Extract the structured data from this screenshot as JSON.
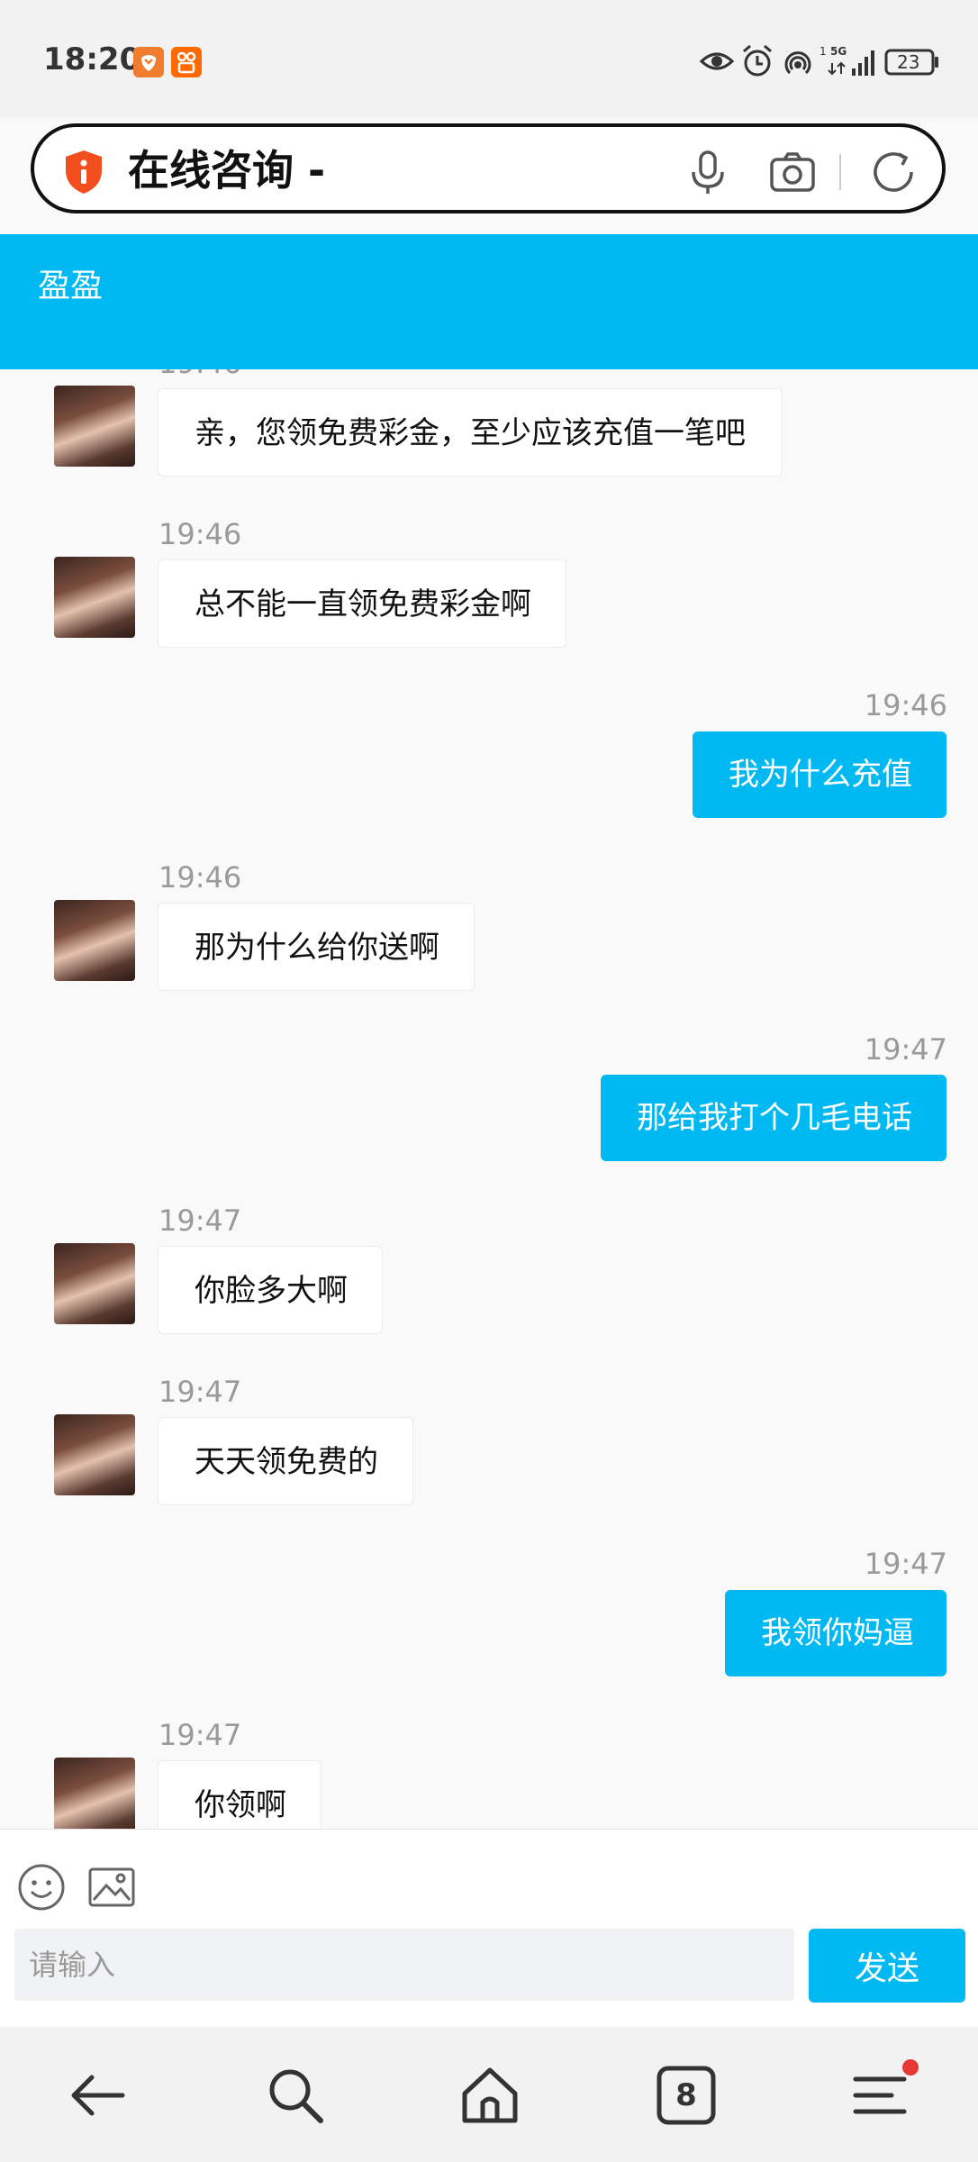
{
  "status_bar": {
    "time": "18:20",
    "battery": "23",
    "network": "5G"
  },
  "browser": {
    "url_title": "在线咨询 -"
  },
  "chat": {
    "title": "盈盈",
    "partial_time": "19:46",
    "messages": [
      {
        "side": "in",
        "time": "",
        "text": "亲，您领免费彩金，至少应该充值一笔吧"
      },
      {
        "side": "in",
        "time": "19:46",
        "text": "总不能一直领免费彩金啊"
      },
      {
        "side": "out",
        "time": "19:46",
        "text": "我为什么充值"
      },
      {
        "side": "in",
        "time": "19:46",
        "text": "那为什么给你送啊"
      },
      {
        "side": "out",
        "time": "19:47",
        "text": "那给我打个几毛电话"
      },
      {
        "side": "in",
        "time": "19:47",
        "text": "你脸多大啊"
      },
      {
        "side": "in",
        "time": "19:47",
        "text": "天天领免费的"
      },
      {
        "side": "out",
        "time": "19:47",
        "text": "我领你妈逼"
      },
      {
        "side": "in",
        "time": "19:47",
        "text": "你领啊"
      }
    ]
  },
  "input": {
    "placeholder": "请输入",
    "send_label": "发送"
  },
  "nav": {
    "tabs_count": "8"
  },
  "colors": {
    "accent": "#00b9f2",
    "notification_dot": "#e53935"
  }
}
